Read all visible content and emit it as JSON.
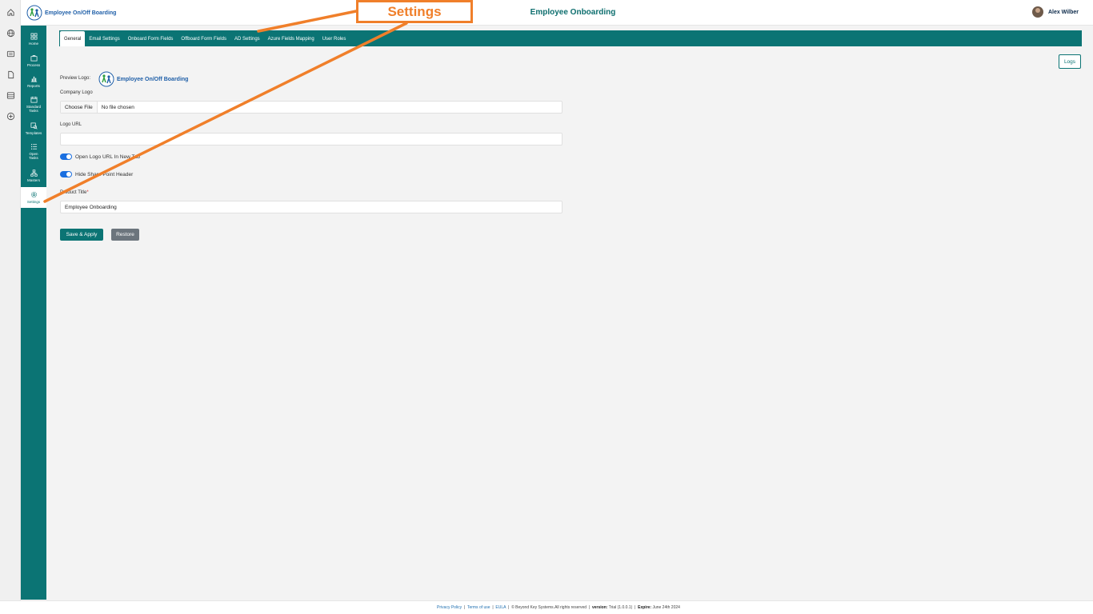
{
  "header": {
    "brand_text": "Employee On/Off Boarding",
    "title": "Employee Onboarding",
    "user_name": "Alex Wilber"
  },
  "sidebar": {
    "items": [
      {
        "label": "Home",
        "icon": "home-grid-icon"
      },
      {
        "label": "Process",
        "icon": "briefcase-icon"
      },
      {
        "label": "Reports",
        "icon": "bar-chart-icon"
      },
      {
        "label": "Standard Tasks",
        "icon": "calendar-icon"
      },
      {
        "label": "Templates",
        "icon": "templates-icon"
      },
      {
        "label": "Open Tasks",
        "icon": "list-icon"
      },
      {
        "label": "Masters",
        "icon": "hierarchy-icon"
      },
      {
        "label": "Settings",
        "icon": "gear-icon",
        "active": true
      }
    ]
  },
  "tabs": [
    {
      "label": "General",
      "active": true
    },
    {
      "label": "Email Settings"
    },
    {
      "label": "Onboard Form Fields"
    },
    {
      "label": "Offboard Form Fields"
    },
    {
      "label": "AD Settings"
    },
    {
      "label": "Azure Fields Mapping"
    },
    {
      "label": "User Roles"
    }
  ],
  "logs_label": "Logs",
  "form": {
    "preview_logo_label": "Preview Logo:",
    "preview_logo_text": "Employee On/Off Boarding",
    "company_logo_label": "Company Logo",
    "choose_file_label": "Choose File",
    "file_status": "No file chosen",
    "logo_url_label": "Logo URL",
    "logo_url_value": "",
    "toggle_open_new_tab": "Open Logo URL In New Tab",
    "toggle_hide_sp_header": "Hide Share Point Header",
    "product_title_label": "Product Title",
    "required_mark": "*",
    "product_title_value": "Employee Onboarding",
    "save_label": "Save & Apply",
    "restore_label": "Restore"
  },
  "footer": {
    "privacy": "Privacy Policy",
    "terms": "Terms of use",
    "eula": "EULA",
    "copyright": "© Beyond Key Systems.All rights reserved",
    "version_label": "version:",
    "version_value": "Trial (1.0.0.1)",
    "expire_label": "Expire:",
    "expire_value": "June 24th 2024"
  },
  "annotation": {
    "callout_text": "Settings"
  },
  "colors": {
    "teal": "#0b7474",
    "accent_orange": "#f07f2a",
    "toggle_blue": "#1a6fe0",
    "restore_gray": "#6c757d"
  }
}
